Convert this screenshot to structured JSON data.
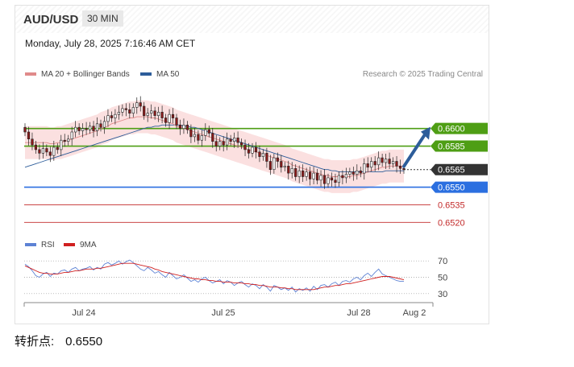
{
  "header": {
    "pair": "AUD/USD",
    "timeframe": "30 MIN",
    "datetime": "Monday, July 28, 2025 7:16:46 AM CET"
  },
  "legend_main": {
    "ma20": "MA 20 + Bollinger Bands",
    "ma50": "MA 50",
    "credit": "Research © 2025 Trading Central"
  },
  "legend_rsi": {
    "rsi": "RSI",
    "ma9": "9MA"
  },
  "colors": {
    "resistance": "#4e9e14",
    "support": "#2b6fe0",
    "support2": "#c32b2b",
    "last": "#333333",
    "ma20": "#e08a8a",
    "ma50": "#2d5d9a",
    "band": "#f9d3d3",
    "rsi": "#5d82d4",
    "ma9": "#d02020",
    "arrow": "#2d5d9a"
  },
  "chart_data": [
    {
      "type": "candlestick",
      "y_range": [
        0.6512,
        0.6632
      ],
      "x_categories": [
        "Jul 24",
        "Jul 25",
        "Jul 28",
        "Aug 2"
      ],
      "levels": [
        {
          "label": "0.6600",
          "value": 0.66,
          "kind": "resistance"
        },
        {
          "label": "0.6585",
          "value": 0.6585,
          "kind": "resistance"
        },
        {
          "label": "0.6565",
          "value": 0.6565,
          "kind": "last"
        },
        {
          "label": "0.6550",
          "value": 0.655,
          "kind": "support"
        },
        {
          "label": "0.6535",
          "value": 0.6535,
          "kind": "support2"
        },
        {
          "label": "0.6520",
          "value": 0.652,
          "kind": "support2"
        }
      ],
      "close": [
        0.6597,
        0.6591,
        0.6586,
        0.6582,
        0.6579,
        0.6583,
        0.658,
        0.6577,
        0.6584,
        0.6582,
        0.659,
        0.6589,
        0.6591,
        0.6597,
        0.6601,
        0.6598,
        0.66,
        0.6599,
        0.6602,
        0.6598,
        0.6604,
        0.6601,
        0.6606,
        0.6611,
        0.6609,
        0.6612,
        0.6614,
        0.6617,
        0.6616,
        0.6613,
        0.6618,
        0.6622,
        0.6619,
        0.6611,
        0.6613,
        0.6615,
        0.6611,
        0.6614,
        0.6609,
        0.6605,
        0.6612,
        0.6609,
        0.6603,
        0.66,
        0.6603,
        0.6599,
        0.6593,
        0.6595,
        0.659,
        0.6594,
        0.6599,
        0.6596,
        0.6589,
        0.6585,
        0.6589,
        0.6586,
        0.6591,
        0.6589,
        0.6592,
        0.6588,
        0.6586,
        0.6582,
        0.6579,
        0.6584,
        0.658,
        0.6576,
        0.6579,
        0.6572,
        0.6565,
        0.6575,
        0.6572,
        0.6567,
        0.6568,
        0.6562,
        0.6566,
        0.6559,
        0.6564,
        0.6559,
        0.6563,
        0.6557,
        0.6562,
        0.6556,
        0.656,
        0.6553,
        0.6558,
        0.6556,
        0.6554,
        0.656,
        0.6558,
        0.6561,
        0.6563,
        0.6561,
        0.6564,
        0.6562,
        0.657,
        0.6567,
        0.6572,
        0.6569,
        0.6575,
        0.6571,
        0.6574,
        0.657,
        0.6572,
        0.6568,
        0.6566,
        0.6565
      ],
      "open_high_low_note": "",
      "ma20": [
        0.6588,
        0.6588,
        0.6588,
        0.6588,
        0.6588,
        0.6588,
        0.6588,
        0.6587,
        0.6587,
        0.6588,
        0.6588,
        0.6589,
        0.659,
        0.6591,
        0.6592,
        0.6593,
        0.6594,
        0.6595,
        0.6596,
        0.6597,
        0.6598,
        0.66,
        0.6601,
        0.6602,
        0.6604,
        0.6605,
        0.6606,
        0.6607,
        0.6608,
        0.6609,
        0.6609,
        0.661,
        0.661,
        0.661,
        0.661,
        0.6609,
        0.6609,
        0.6608,
        0.6607,
        0.6606,
        0.6605,
        0.6604,
        0.6602,
        0.6601,
        0.66,
        0.6599,
        0.6598,
        0.6597,
        0.6596,
        0.6595,
        0.6594,
        0.6593,
        0.6592,
        0.6591,
        0.659,
        0.6589,
        0.6588,
        0.6587,
        0.6586,
        0.6585,
        0.6584,
        0.6583,
        0.6582,
        0.6581,
        0.658,
        0.6579,
        0.6578,
        0.6577,
        0.6576,
        0.6575,
        0.6574,
        0.6573,
        0.6572,
        0.6571,
        0.6569,
        0.6568,
        0.6567,
        0.6566,
        0.6565,
        0.6564,
        0.6563,
        0.6562,
        0.6561,
        0.656,
        0.656,
        0.6559,
        0.6559,
        0.6559,
        0.6559,
        0.6559,
        0.6559,
        0.656,
        0.656,
        0.6561,
        0.6562,
        0.6563,
        0.6564,
        0.6565,
        0.6566,
        0.6567,
        0.6567,
        0.6568,
        0.6568,
        0.6568,
        0.6568,
        0.6568
      ],
      "band_width": 0.0014,
      "ma50": [
        0.6567,
        0.6568,
        0.6569,
        0.657,
        0.6571,
        0.6572,
        0.6573,
        0.6574,
        0.6575,
        0.6576,
        0.6577,
        0.6578,
        0.6579,
        0.658,
        0.6581,
        0.6582,
        0.6583,
        0.6584,
        0.6585,
        0.6586,
        0.6587,
        0.6588,
        0.6589,
        0.659,
        0.6591,
        0.6592,
        0.6593,
        0.6594,
        0.6595,
        0.6596,
        0.6597,
        0.6598,
        0.6599,
        0.66,
        0.6601,
        0.6601,
        0.6602,
        0.6602,
        0.6603,
        0.6603,
        0.6603,
        0.6603,
        0.6603,
        0.6603,
        0.6602,
        0.6602,
        0.6601,
        0.6601,
        0.66,
        0.6599,
        0.6598,
        0.6597,
        0.6596,
        0.6595,
        0.6594,
        0.6593,
        0.6592,
        0.6591,
        0.659,
        0.6589,
        0.6588,
        0.6587,
        0.6586,
        0.6585,
        0.6584,
        0.6583,
        0.6582,
        0.6581,
        0.658,
        0.6579,
        0.6578,
        0.6577,
        0.6576,
        0.6575,
        0.6574,
        0.6573,
        0.6572,
        0.6571,
        0.657,
        0.6569,
        0.6568,
        0.6567,
        0.6566,
        0.6565,
        0.6565,
        0.6564,
        0.6564,
        0.6563,
        0.6563,
        0.6563,
        0.6563,
        0.6563,
        0.6563,
        0.6563,
        0.6563,
        0.6563,
        0.6563,
        0.6563,
        0.6563,
        0.6563,
        0.6564,
        0.6564,
        0.6564,
        0.6564,
        0.6564,
        0.6564
      ],
      "projection": {
        "from_value": 0.6565,
        "to_value": 0.66
      }
    },
    {
      "type": "line",
      "y_range": [
        20,
        80
      ],
      "y_ticks": [
        70,
        50,
        30
      ],
      "series": [
        {
          "name": "RSI",
          "values": [
            66,
            63,
            58,
            52,
            50,
            54,
            56,
            51,
            55,
            54,
            58,
            59,
            56,
            60,
            62,
            58,
            60,
            61,
            63,
            59,
            62,
            60,
            66,
            68,
            65,
            67,
            70,
            66,
            69,
            71,
            68,
            64,
            60,
            58,
            62,
            59,
            55,
            57,
            53,
            50,
            56,
            52,
            48,
            50,
            53,
            49,
            45,
            47,
            44,
            48,
            50,
            46,
            43,
            45,
            47,
            42,
            46,
            44,
            40,
            43,
            45,
            41,
            38,
            42,
            40,
            36,
            41,
            38,
            33,
            40,
            38,
            35,
            37,
            34,
            38,
            32,
            36,
            34,
            37,
            33,
            39,
            35,
            40,
            41,
            38,
            42,
            44,
            40,
            45,
            46,
            44,
            48,
            50,
            47,
            52,
            55,
            51,
            56,
            60,
            54,
            52,
            50,
            48,
            46,
            45,
            45
          ]
        },
        {
          "name": "9MA",
          "values": [
            64,
            62,
            60,
            58,
            56,
            55,
            55,
            54,
            54,
            54,
            55,
            56,
            56,
            57,
            58,
            58,
            59,
            60,
            60,
            60,
            61,
            61,
            62,
            63,
            64,
            65,
            66,
            67,
            67,
            67,
            67,
            66,
            65,
            64,
            63,
            62,
            60,
            59,
            57,
            56,
            55,
            54,
            53,
            52,
            51,
            50,
            49,
            48,
            48,
            47,
            47,
            46,
            46,
            45,
            45,
            44,
            44,
            44,
            43,
            43,
            43,
            42,
            42,
            41,
            41,
            40,
            40,
            39,
            38,
            38,
            38,
            37,
            37,
            36,
            36,
            35,
            35,
            35,
            35,
            35,
            35,
            36,
            37,
            38,
            38,
            39,
            40,
            40,
            41,
            42,
            42,
            43,
            44,
            45,
            46,
            47,
            48,
            49,
            50,
            51,
            51,
            51,
            50,
            49,
            48,
            47
          ]
        }
      ]
    }
  ],
  "pivot": {
    "label": "转折点:",
    "value": "0.6550"
  }
}
